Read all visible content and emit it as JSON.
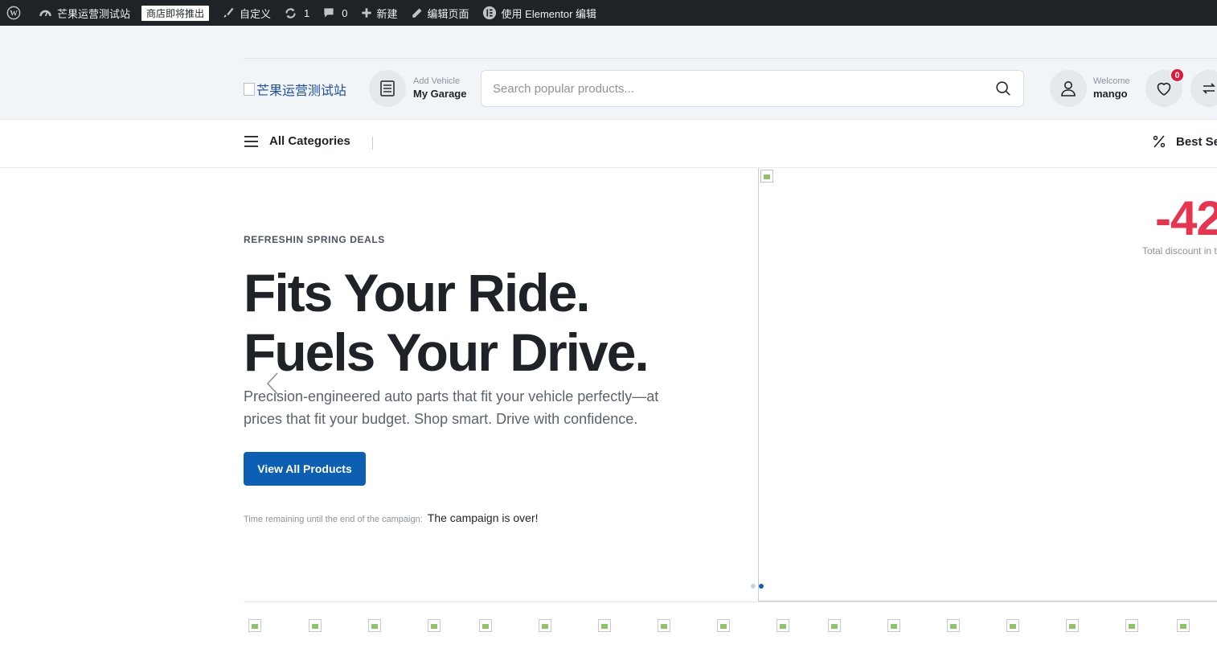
{
  "adminbar": {
    "site_name": "芒果运营测试站",
    "store_badge": "商店即将推出",
    "customize": "自定义",
    "updates_count": "1",
    "comments_count": "0",
    "new_label": "新建",
    "edit_page": "编辑页面",
    "elementor": "使用 Elementor 编辑"
  },
  "header": {
    "logo_text": "芒果运营测试站",
    "garage": {
      "small": "Add Vehicle",
      "bold": "My Garage"
    },
    "search": {
      "placeholder": "Search popular products...",
      "value": ""
    },
    "account": {
      "small": "Welcome",
      "bold": "mango"
    },
    "wishlist_count": "0"
  },
  "nav": {
    "all_categories": "All Categories",
    "best_sellers": "Best Se"
  },
  "hero": {
    "eyebrow": "REFRESHIN SPRING DEALS",
    "headline_line1": "Fits Your Ride.",
    "headline_line2": "Fuels Your Drive.",
    "description": "Precision-engineered auto parts that fit your vehicle perfectly—at prices that fit your budget. Shop smart. Drive with confidence.",
    "cta_label": "View All Products",
    "timer_label": "Time remaining until the end of the campaign:",
    "timer_value": "The campaign is over!",
    "discount": "-42",
    "discount_note": "Total discount in t"
  },
  "colors": {
    "admin_bg": "#1d2327",
    "primary": "#0d5fb3",
    "discount": "#e8344e",
    "badge": "#e3193b",
    "header_bg": "#f2f5f8"
  }
}
